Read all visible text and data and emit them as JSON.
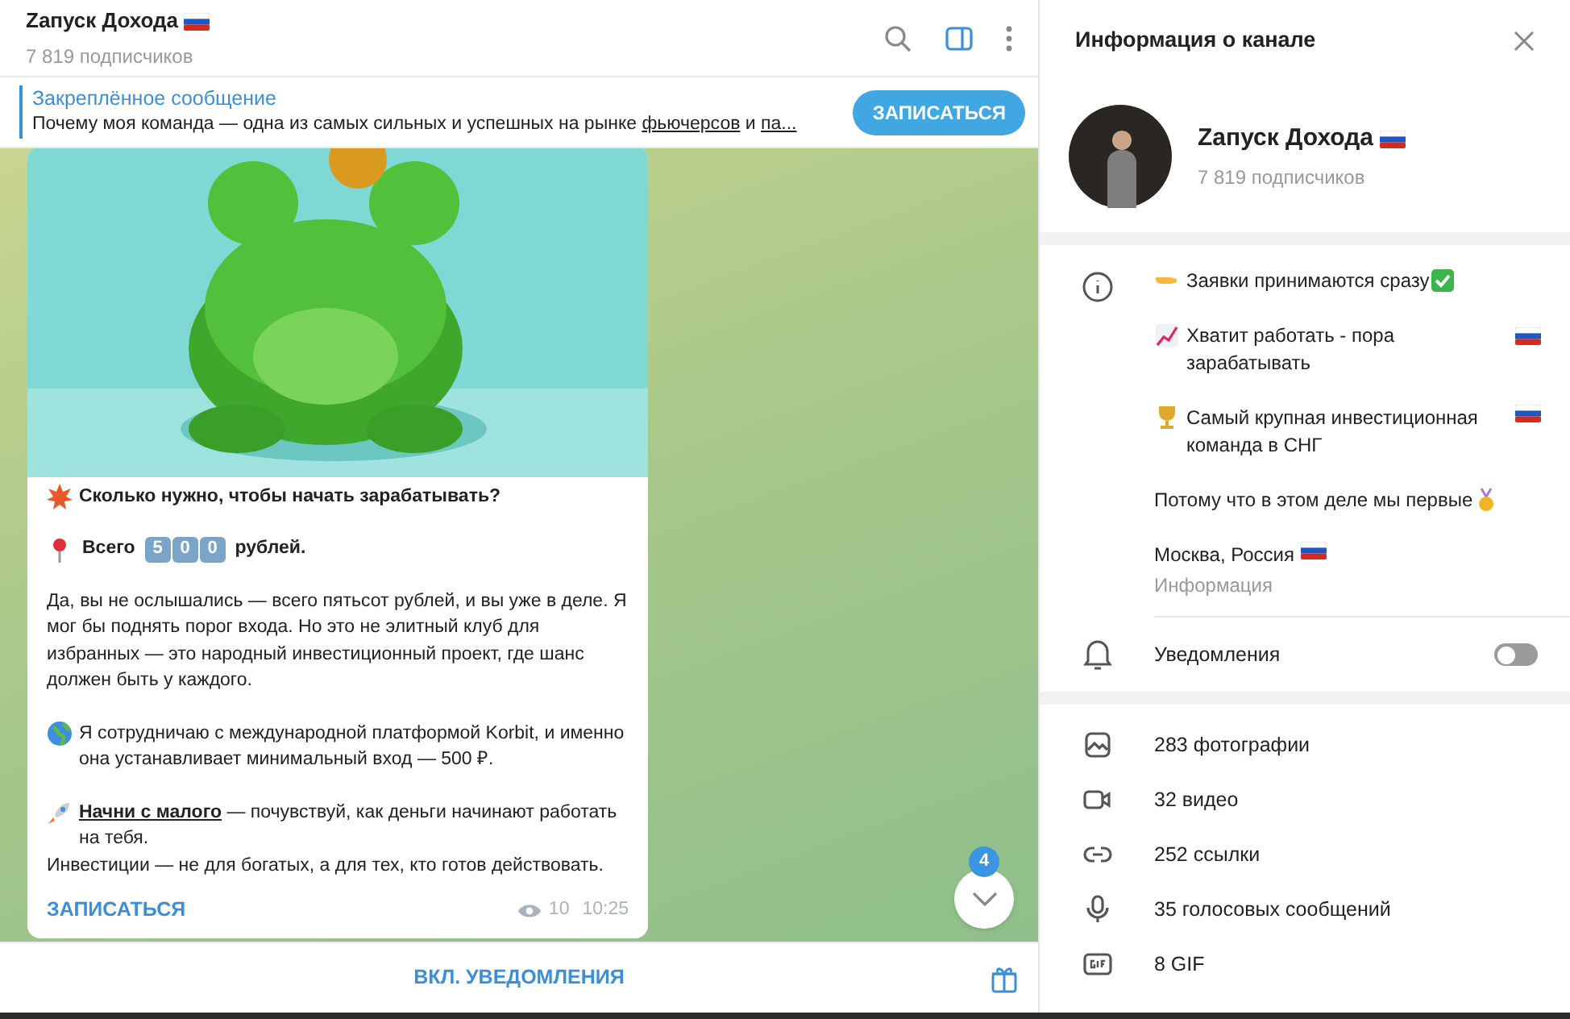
{
  "chat": {
    "title": "Zапуск Дохода",
    "subtitle": "7 819 подписчиков"
  },
  "pinned": {
    "label": "Закреплённое сообщение",
    "text_start": "Почему моя команда — одна из самых сильных и успешных на рынке ",
    "link_1": "фьючерсов",
    "text_mid": " и ",
    "link_2": "па...",
    "button": "ЗАПИСАТЬСЯ"
  },
  "message": {
    "heading": "Сколько нужно, чтобы начать зарабатывать?",
    "price_prefix": "Всего",
    "price_digits": [
      "5",
      "0",
      "0"
    ],
    "price_suffix": "рублей.",
    "body": "Да, вы не ослышались — всего пятьсот рублей, и вы уже в деле. Я мог бы поднять порог входа. Но это не элитный клуб для избранных — это народный инвестиционный проект, где шанс должен быть у каждого.",
    "platform": "Я сотрудничаю с международной платформой Korbit, и именно она устанавливает минимальный вход — 500 ₽.",
    "start_link": "Начни с малого",
    "start_rest": " — почувствуй, как деньги начинают работать на тебя.",
    "closing": "Инвестиции — не для богатых, а для тех, кто готов действовать.",
    "button": "ЗАПИСАТЬСЯ",
    "views": "10",
    "time": "10:25"
  },
  "scroll_badge": "4",
  "bottom_bar": {
    "button": "ВКЛ. УВЕДОМЛЕНИЯ"
  },
  "info_panel": {
    "title": "Информация о канале",
    "name": "Zапуск Дохода",
    "subscribers": "7 819 подписчиков",
    "about": [
      "Заявки принимаются сразу",
      "Хватит работать - пора зарабатывать",
      "Самый крупная инвестиционная команда в СНГ",
      "Потому что в этом деле мы первые",
      "Москва, Россия"
    ],
    "about_caption": "Информация",
    "notifications": {
      "label": "Уведомления",
      "on": false
    },
    "media": [
      {
        "label": "283 фотографии"
      },
      {
        "label": "32 видео"
      },
      {
        "label": "252 ссылки"
      },
      {
        "label": "35 голосовых сообщений"
      },
      {
        "label": "8 GIF"
      }
    ]
  }
}
